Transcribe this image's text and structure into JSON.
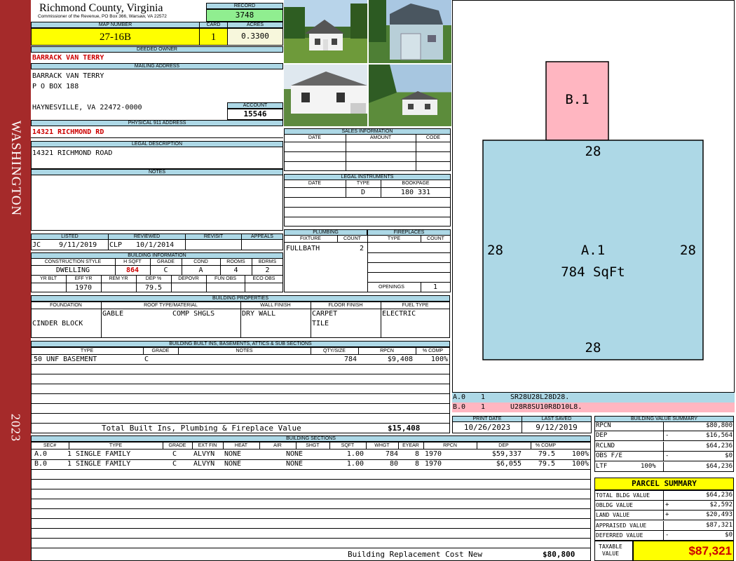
{
  "sidebar": {
    "top": "WASHINGTON",
    "bottom": "2023"
  },
  "header": {
    "county": "Richmond County, Virginia",
    "address": "Commissioner of the Revenue, PO Box 366, Warsaw, VA 22572",
    "record_label": "RECORD",
    "record": "3748"
  },
  "parcel": {
    "map_label": "MAP NUMBER",
    "map": "27-16B",
    "card_label": "CARD",
    "card": "1",
    "acres_label": "ACRES",
    "acres": "0.3300"
  },
  "owner": {
    "deeded_label": "DEEDED OWNER",
    "deeded": "BARRACK VAN TERRY",
    "mailing_label": "MAILING ADDRESS",
    "line1": "BARRACK VAN TERRY",
    "line2": "P O BOX 188",
    "line3": "HAYNESVILLE, VA 22472-0000",
    "account_label": "ACCOUNT",
    "account": "15546"
  },
  "physical": {
    "label": "PHYSICAL 911 ADDRESS",
    "value": "14321 RICHMOND RD"
  },
  "legal": {
    "label": "LEGAL DESCRIPTION",
    "value": "14321 RICHMOND ROAD"
  },
  "notes": {
    "label": "NOTES"
  },
  "sales": {
    "label": "SALES INFORMATION",
    "cols": [
      "DATE",
      "AMOUNT",
      "CODE"
    ]
  },
  "instruments": {
    "label": "LEGAL INSTRUMENTS",
    "cols": [
      "DATE",
      "TYPE",
      "BOOKPAGE"
    ],
    "row": {
      "type": "D",
      "bookpage": "180 331"
    }
  },
  "listed": {
    "listed_label": "LISTED",
    "reviewed_label": "REVIEWED",
    "revisit_label": "REVISIT",
    "appeals_label": "APPEALS",
    "listed_by": "JC",
    "listed_date": "9/11/2019",
    "reviewed_by": "CLP",
    "reviewed_date": "10/1/2014"
  },
  "bldg": {
    "label": "BUILDING INFORMATION",
    "cols": [
      "CONSTRUCTION STYLE",
      "H SQFT",
      "GRADE",
      "COND",
      "ROOMS",
      "BDRMS"
    ],
    "vals": [
      "DWELLING",
      "864",
      "C",
      "A",
      "4",
      "2"
    ],
    "cols2": [
      "YR BLT",
      "EFF YR",
      "REM YR",
      "DEP %",
      "DEPOVR",
      "FUN OBS",
      "ECO OBS"
    ],
    "vals2": [
      "",
      "1970",
      "",
      "79.5",
      "",
      "",
      ""
    ]
  },
  "plumbing": {
    "label": "PLUMBING",
    "cols": [
      "FIXTURE",
      "COUNT"
    ],
    "fixture": "FULLBATH",
    "count": "2"
  },
  "fireplaces": {
    "label": "FIREPLACES",
    "cols": [
      "TYPE",
      "COUNT"
    ],
    "openings_label": "OPENINGS",
    "openings": "1"
  },
  "props": {
    "label": "BUILDING PROPERTIES",
    "cols": [
      "FOUNDATION",
      "ROOF TYPE/MATERIAL",
      "WALL FINISH",
      "FLOOR FINISH",
      "FUEL TYPE"
    ],
    "foundation": "CINDER BLOCK",
    "roof_type": "GABLE",
    "roof_mat": "COMP SHGLS",
    "wall": "DRY WALL",
    "floor1": "CARPET",
    "floor2": "TILE",
    "fuel": "ELECTRIC"
  },
  "builtins": {
    "label": "BUILDING BUILT INS, BASEMENTS, ATTICS & SUB SECTIONS",
    "cols": [
      "TYPE",
      "GRADE",
      "NOTES",
      "QTY/SIZE",
      "RPCN",
      "% COMP"
    ],
    "row": {
      "type": "50 UNF BASEMENT",
      "grade": "C",
      "notes": "",
      "qty": "784",
      "rpcn": "$9,408",
      "comp": "100%"
    },
    "total_label": "Total Built Ins, Plumbing & Fireplace Value",
    "total": "$15,408"
  },
  "sections": {
    "label": "BUILDING SECTIONS",
    "cols": [
      "SEC#",
      "TYPE",
      "GRADE",
      "EXT FIN",
      "HEAT",
      "AIR",
      "SHGT",
      "SQFT",
      "WHGT",
      "EYEAR",
      "RPCN",
      "DEP",
      "% COMP"
    ],
    "rows": [
      {
        "sec": "A.0",
        "type": "1 SINGLE FAMILY",
        "grade": "C",
        "ext": "ALVYN",
        "heat": "NONE",
        "air": "NONE",
        "shgt": "1.00",
        "sqft": "784",
        "whgt": "8",
        "eyear": "1970",
        "rpcn": "$59,337",
        "dep": "79.5",
        "comp": "100%"
      },
      {
        "sec": "B.0",
        "type": "1 SINGLE FAMILY",
        "grade": "C",
        "ext": "ALVYN",
        "heat": "NONE",
        "air": "NONE",
        "shgt": "1.00",
        "sqft": "80",
        "whgt": "8",
        "eyear": "1970",
        "rpcn": "$6,055",
        "dep": "79.5",
        "comp": "100%"
      }
    ],
    "total_label": "Building Replacement Cost New",
    "total": "$80,800"
  },
  "sketch": {
    "b_label": "B.1",
    "a_label": "A.1",
    "a_area": "784 SqFt",
    "dim_top": "28",
    "dim_bottom": "28",
    "dim_left": "28",
    "dim_right": "28"
  },
  "sketch_codes": [
    {
      "sec": "A.0",
      "n": "1",
      "code": "SR28U28L28D28."
    },
    {
      "sec": "B.0",
      "n": "1",
      "code": "U28R8SU10R8D10L8."
    }
  ],
  "dates": {
    "print_label": "PRINT DATE",
    "print": "10/26/2023",
    "saved_label": "LAST SAVED",
    "saved": "9/12/2019"
  },
  "value_summary": {
    "label": "BUILDING VALUE SUMMARY",
    "rows": [
      {
        "l": "RPCN",
        "s": "",
        "r": "$80,800"
      },
      {
        "l": "DEP",
        "s": "-",
        "r": "$16,564"
      },
      {
        "l": "RCLND",
        "s": "",
        "r": "$64,236"
      },
      {
        "l": "OBS F/E",
        "s": "-",
        "r": "$0"
      },
      {
        "l": "LTF",
        "pct": "100%",
        "s": "",
        "r": "$64,236"
      }
    ]
  },
  "parcel_summary": {
    "label": "PARCEL SUMMARY",
    "rows": [
      {
        "l": "TOTAL BLDG VALUE",
        "s": "",
        "r": "$64,236"
      },
      {
        "l": "OBLDG VALUE",
        "s": "+",
        "r": "$2,592"
      },
      {
        "l": "LAND VALUE",
        "s": "+",
        "r": "$20,493"
      },
      {
        "l": "APPRAISED VALUE",
        "s": "",
        "r": "$87,321"
      },
      {
        "l": "DEFERRED VALUE",
        "s": "-",
        "r": "$0"
      }
    ],
    "taxable_label": "TAXABLE VALUE",
    "taxable": "$87,321"
  },
  "colors": {
    "header_blue": "#add8e6",
    "sidebar": "#a52a2a",
    "yellow": "#ffff00",
    "green": "#90ee90",
    "pink": "#ffb6c1"
  }
}
